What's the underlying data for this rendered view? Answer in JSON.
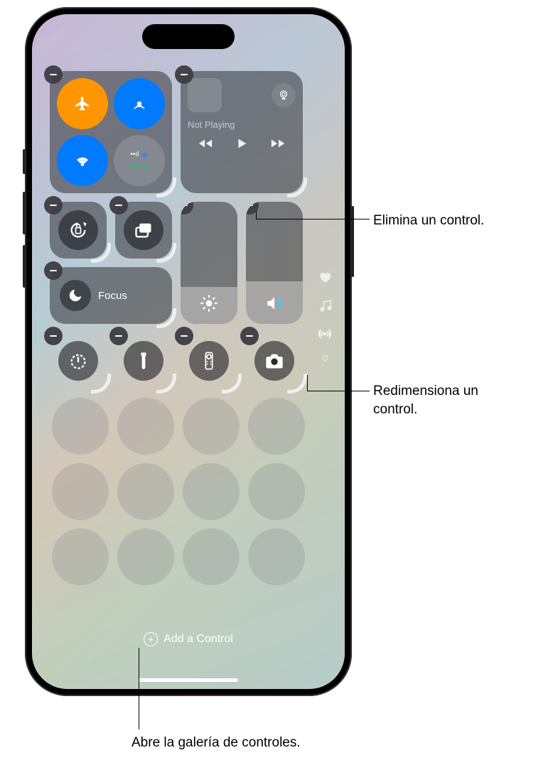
{
  "media": {
    "status": "Not Playing"
  },
  "focus": {
    "label": "Focus"
  },
  "add_control": {
    "label": "Add a Control"
  },
  "callouts": {
    "remove": "Elimina un control.",
    "resize": "Redimensiona un control.",
    "gallery": "Abre la galería de controles."
  },
  "icons": {
    "airplane": "airplane",
    "airdrop": "airdrop",
    "wifi": "wifi",
    "cellular": "cellular",
    "bluetooth": "bluetooth",
    "hotspot": "hotspot",
    "airplay": "airplay",
    "rewind": "rewind",
    "play": "play",
    "forward": "forward",
    "orientation_lock": "orientation-lock",
    "screen_mirror": "screen-mirror",
    "moon": "moon",
    "brightness": "brightness",
    "volume": "volume",
    "timer": "timer",
    "flashlight": "flashlight",
    "remote": "remote",
    "camera": "camera",
    "heart": "heart",
    "music_note": "music-note",
    "antenna": "antenna"
  }
}
